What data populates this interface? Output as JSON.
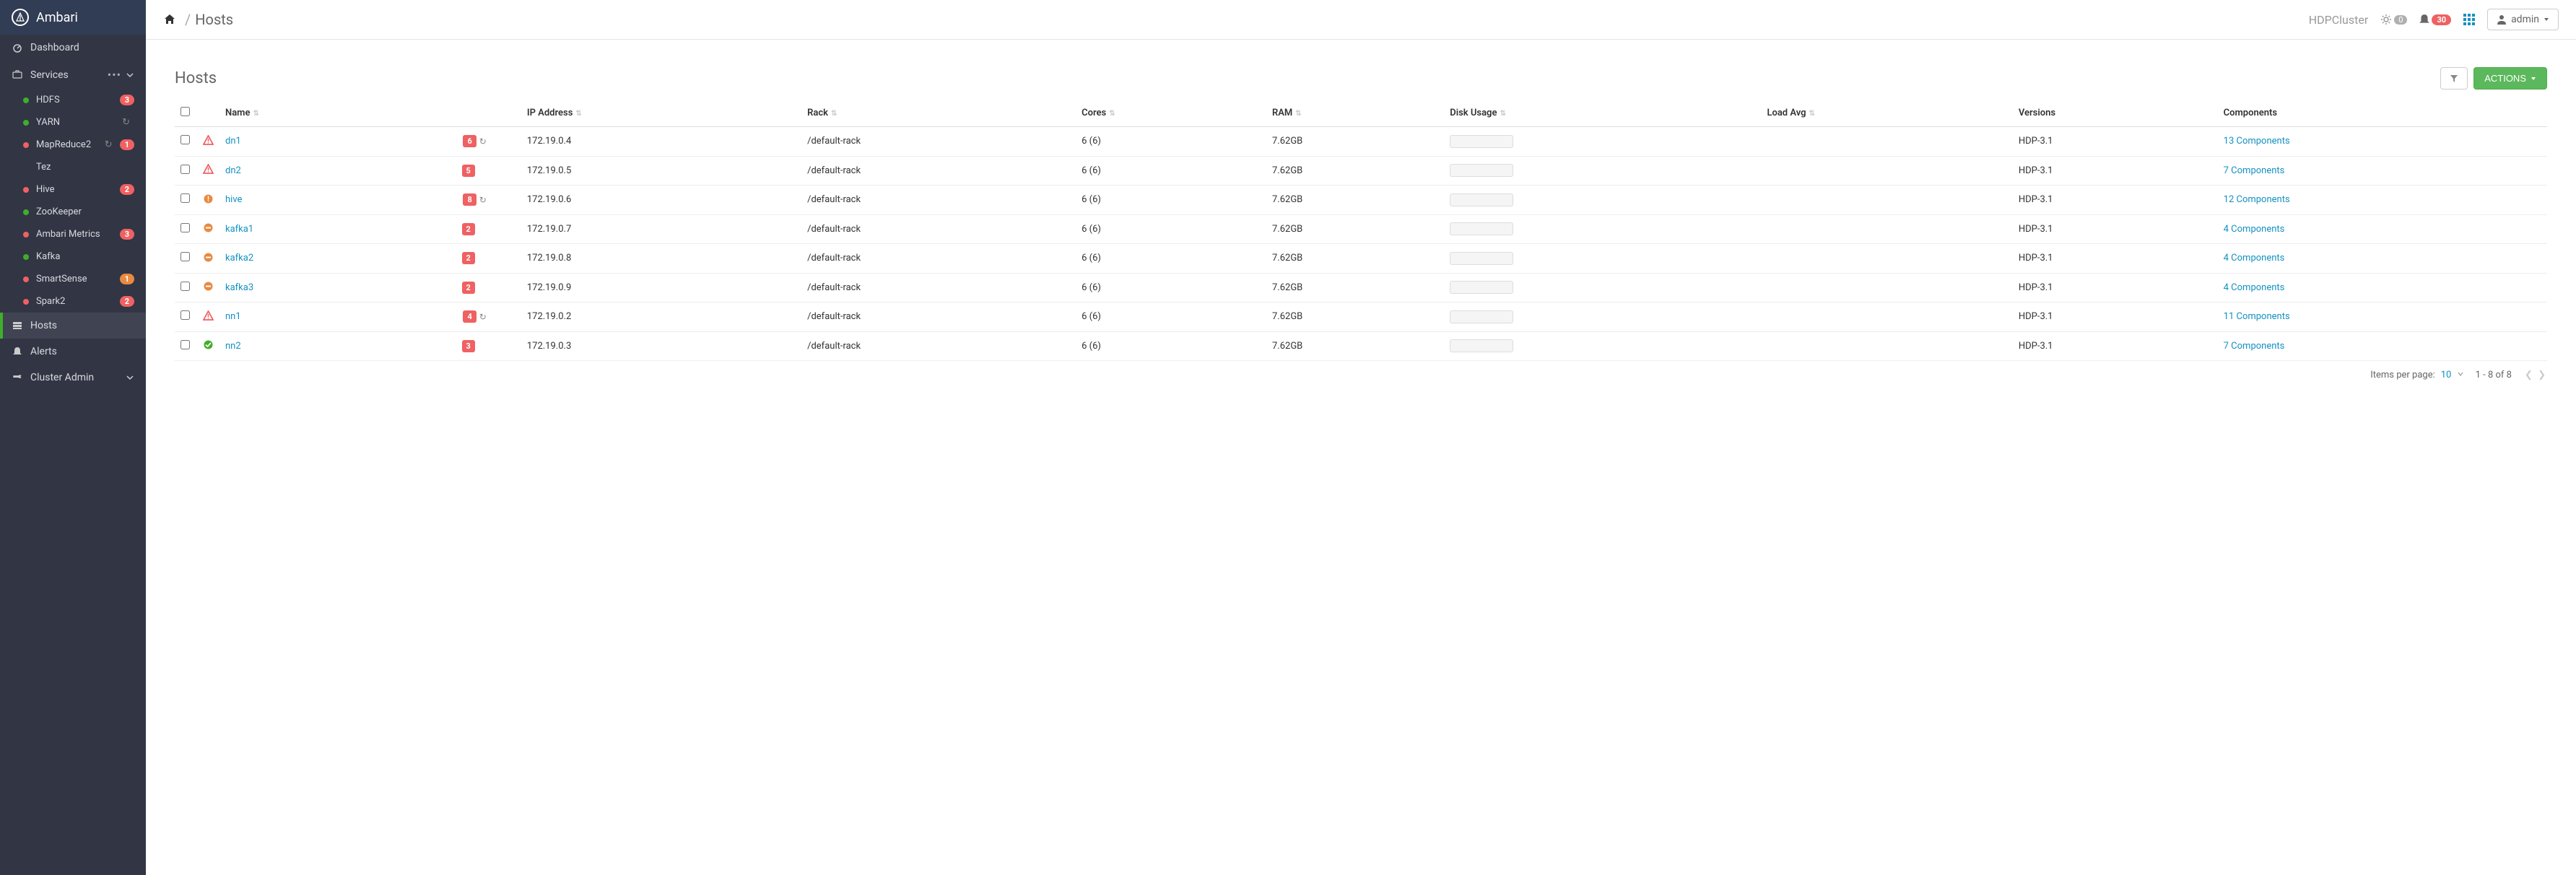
{
  "app_name": "Ambari",
  "sidebar": {
    "dashboard": "Dashboard",
    "services_label": "Services",
    "hosts": "Hosts",
    "alerts": "Alerts",
    "cluster_admin": "Cluster Admin",
    "services": [
      {
        "name": "HDFS",
        "dot": "green",
        "badge": "3",
        "badge_color": "red",
        "refresh": false
      },
      {
        "name": "YARN",
        "dot": "green",
        "badge": "",
        "badge_color": "",
        "refresh": true
      },
      {
        "name": "MapReduce2",
        "dot": "red",
        "badge": "1",
        "badge_color": "red",
        "refresh": true
      },
      {
        "name": "Tez",
        "dot": "none",
        "badge": "",
        "badge_color": "",
        "refresh": false
      },
      {
        "name": "Hive",
        "dot": "red",
        "badge": "2",
        "badge_color": "red",
        "refresh": false
      },
      {
        "name": "ZooKeeper",
        "dot": "green",
        "badge": "",
        "badge_color": "",
        "refresh": false
      },
      {
        "name": "Ambari Metrics",
        "dot": "red",
        "badge": "3",
        "badge_color": "red",
        "refresh": false
      },
      {
        "name": "Kafka",
        "dot": "green",
        "badge": "",
        "badge_color": "",
        "refresh": false
      },
      {
        "name": "SmartSense",
        "dot": "red",
        "badge": "1",
        "badge_color": "orange",
        "refresh": false
      },
      {
        "name": "Spark2",
        "dot": "red",
        "badge": "2",
        "badge_color": "red",
        "refresh": false
      }
    ]
  },
  "topbar": {
    "breadcrumb_current": "Hosts",
    "cluster": "HDPCluster",
    "gear_count": "0",
    "bell_count": "30",
    "user": "admin"
  },
  "page": {
    "title": "Hosts",
    "actions_label": "ACTIONS",
    "columns": {
      "name": "Name",
      "ip": "IP Address",
      "rack": "Rack",
      "cores": "Cores",
      "ram": "RAM",
      "disk": "Disk Usage",
      "load": "Load Avg",
      "versions": "Versions",
      "components": "Components"
    },
    "rows": [
      {
        "status": "critical",
        "name": "dn1",
        "alerts": "6",
        "restart": true,
        "ip": "172.19.0.4",
        "rack": "/default-rack",
        "cores": "6 (6)",
        "ram": "7.62GB",
        "version": "HDP-3.1",
        "components": "13 Components"
      },
      {
        "status": "critical",
        "name": "dn2",
        "alerts": "5",
        "restart": false,
        "ip": "172.19.0.5",
        "rack": "/default-rack",
        "cores": "6 (6)",
        "ram": "7.62GB",
        "version": "HDP-3.1",
        "components": "7 Components"
      },
      {
        "status": "warning",
        "name": "hive",
        "alerts": "8",
        "restart": true,
        "ip": "172.19.0.6",
        "rack": "/default-rack",
        "cores": "6 (6)",
        "ram": "7.62GB",
        "version": "HDP-3.1",
        "components": "12 Components"
      },
      {
        "status": "maintenance",
        "name": "kafka1",
        "alerts": "2",
        "restart": false,
        "ip": "172.19.0.7",
        "rack": "/default-rack",
        "cores": "6 (6)",
        "ram": "7.62GB",
        "version": "HDP-3.1",
        "components": "4 Components"
      },
      {
        "status": "maintenance",
        "name": "kafka2",
        "alerts": "2",
        "restart": false,
        "ip": "172.19.0.8",
        "rack": "/default-rack",
        "cores": "6 (6)",
        "ram": "7.62GB",
        "version": "HDP-3.1",
        "components": "4 Components"
      },
      {
        "status": "maintenance",
        "name": "kafka3",
        "alerts": "2",
        "restart": false,
        "ip": "172.19.0.9",
        "rack": "/default-rack",
        "cores": "6 (6)",
        "ram": "7.62GB",
        "version": "HDP-3.1",
        "components": "4 Components"
      },
      {
        "status": "critical",
        "name": "nn1",
        "alerts": "4",
        "restart": true,
        "ip": "172.19.0.2",
        "rack": "/default-rack",
        "cores": "6 (6)",
        "ram": "7.62GB",
        "version": "HDP-3.1",
        "components": "11 Components"
      },
      {
        "status": "ok",
        "name": "nn2",
        "alerts": "3",
        "restart": false,
        "ip": "172.19.0.3",
        "rack": "/default-rack",
        "cores": "6 (6)",
        "ram": "7.62GB",
        "version": "HDP-3.1",
        "components": "7 Components"
      }
    ],
    "footer": {
      "items_per_page_label": "Items per page:",
      "items_per_page": "10",
      "range": "1 - 8 of 8"
    }
  }
}
